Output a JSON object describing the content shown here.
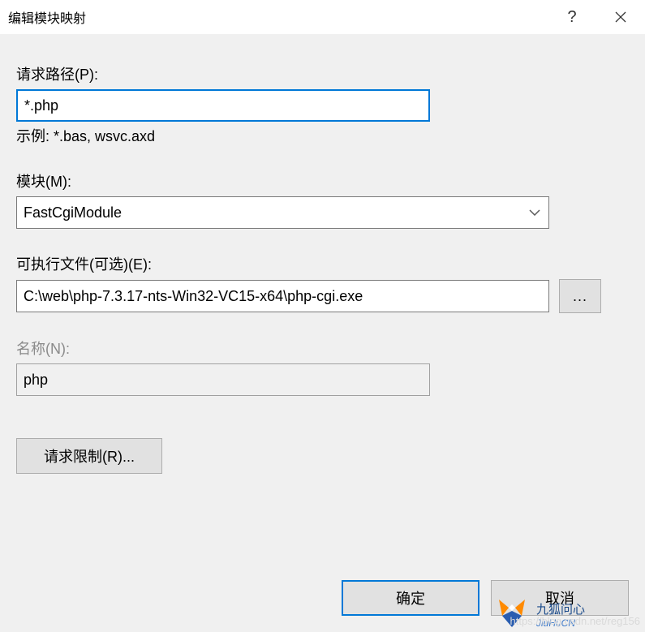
{
  "titlebar": {
    "title": "编辑模块映射",
    "help": "?",
    "close": "×"
  },
  "fields": {
    "requestPath": {
      "label": "请求路径(P):",
      "value": "*.php",
      "hint": "示例: *.bas, wsvc.axd"
    },
    "module": {
      "label": "模块(M):",
      "value": "FastCgiModule"
    },
    "executable": {
      "label": "可执行文件(可选)(E):",
      "value": "C:\\web\\php-7.3.17-nts-Win32-VC15-x64\\php-cgi.exe",
      "browse": "..."
    },
    "name": {
      "label": "名称(N):",
      "value": "php"
    }
  },
  "buttons": {
    "requestRestrictions": "请求限制(R)...",
    "ok": "确定",
    "cancel": "取消"
  },
  "watermark": {
    "url": "https://blog.csdn.net/reg156",
    "brandCn": "九狐问心",
    "brandEn": "JiuHuCN"
  }
}
